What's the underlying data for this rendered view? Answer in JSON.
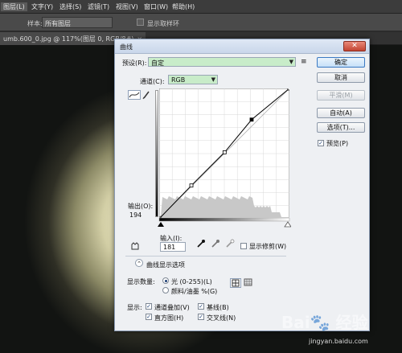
{
  "menubar": {
    "items": [
      "图层(L)",
      "文字(Y)",
      "选择(S)",
      "滤镜(T)",
      "视图(V)",
      "窗口(W)",
      "帮助(H)"
    ]
  },
  "optionsbar": {
    "sample_label": "样本:",
    "sample_value": "所有图层",
    "show_ring_label": "显示取样环"
  },
  "document": {
    "tab_label": "umb.600_0.jpg @ 117%(图层 0, RGB/8#)",
    "close_glyph": "×"
  },
  "dialog": {
    "title": "曲线",
    "close_glyph": "✕",
    "preset_label": "预设(R):",
    "preset_value": "自定",
    "preset_menu_icon": "≡",
    "channel_label": "通道(C):",
    "channel_value": "RGB",
    "output_label": "输出(O):",
    "output_value": "194",
    "input_label": "输入(I):",
    "input_value": "181",
    "show_clipping_label": "显示修剪(W)",
    "show_clipping_checked": false,
    "buttons": {
      "ok": "确定",
      "cancel": "取消",
      "smooth": "平滑(M)",
      "auto": "自动(A)",
      "options": "选项(T)..."
    },
    "preview_label": "预览(P)",
    "preview_checked": true,
    "curve_options_label": "曲线显示选项",
    "display_amount_label": "显示数量:",
    "light_label": "光 (0-255)(L)",
    "pigment_label": "颜料/油墨 %(G)",
    "light_selected": true,
    "show_label": "显示:",
    "show_options": [
      {
        "label": "通道叠加(V)",
        "checked": true
      },
      {
        "label": "基线(B)",
        "checked": true
      },
      {
        "label": "直方图(H)",
        "checked": true
      },
      {
        "label": "交叉线(N)",
        "checked": true
      }
    ],
    "check_glyph": "✓",
    "chevron_glyph": "⌃",
    "dropdown_glyph": "▼"
  },
  "curve": {
    "points": [
      [
        0,
        0
      ],
      [
        63,
        65
      ],
      [
        128,
        130
      ],
      [
        181,
        194
      ],
      [
        255,
        255
      ]
    ],
    "histogram_color": "#c8c8c8",
    "curve_color": "#000000",
    "accent": "#c8ecc9"
  },
  "watermark": {
    "logo": "Bai🐾 经验",
    "url": "jingyan.baidu.com"
  }
}
